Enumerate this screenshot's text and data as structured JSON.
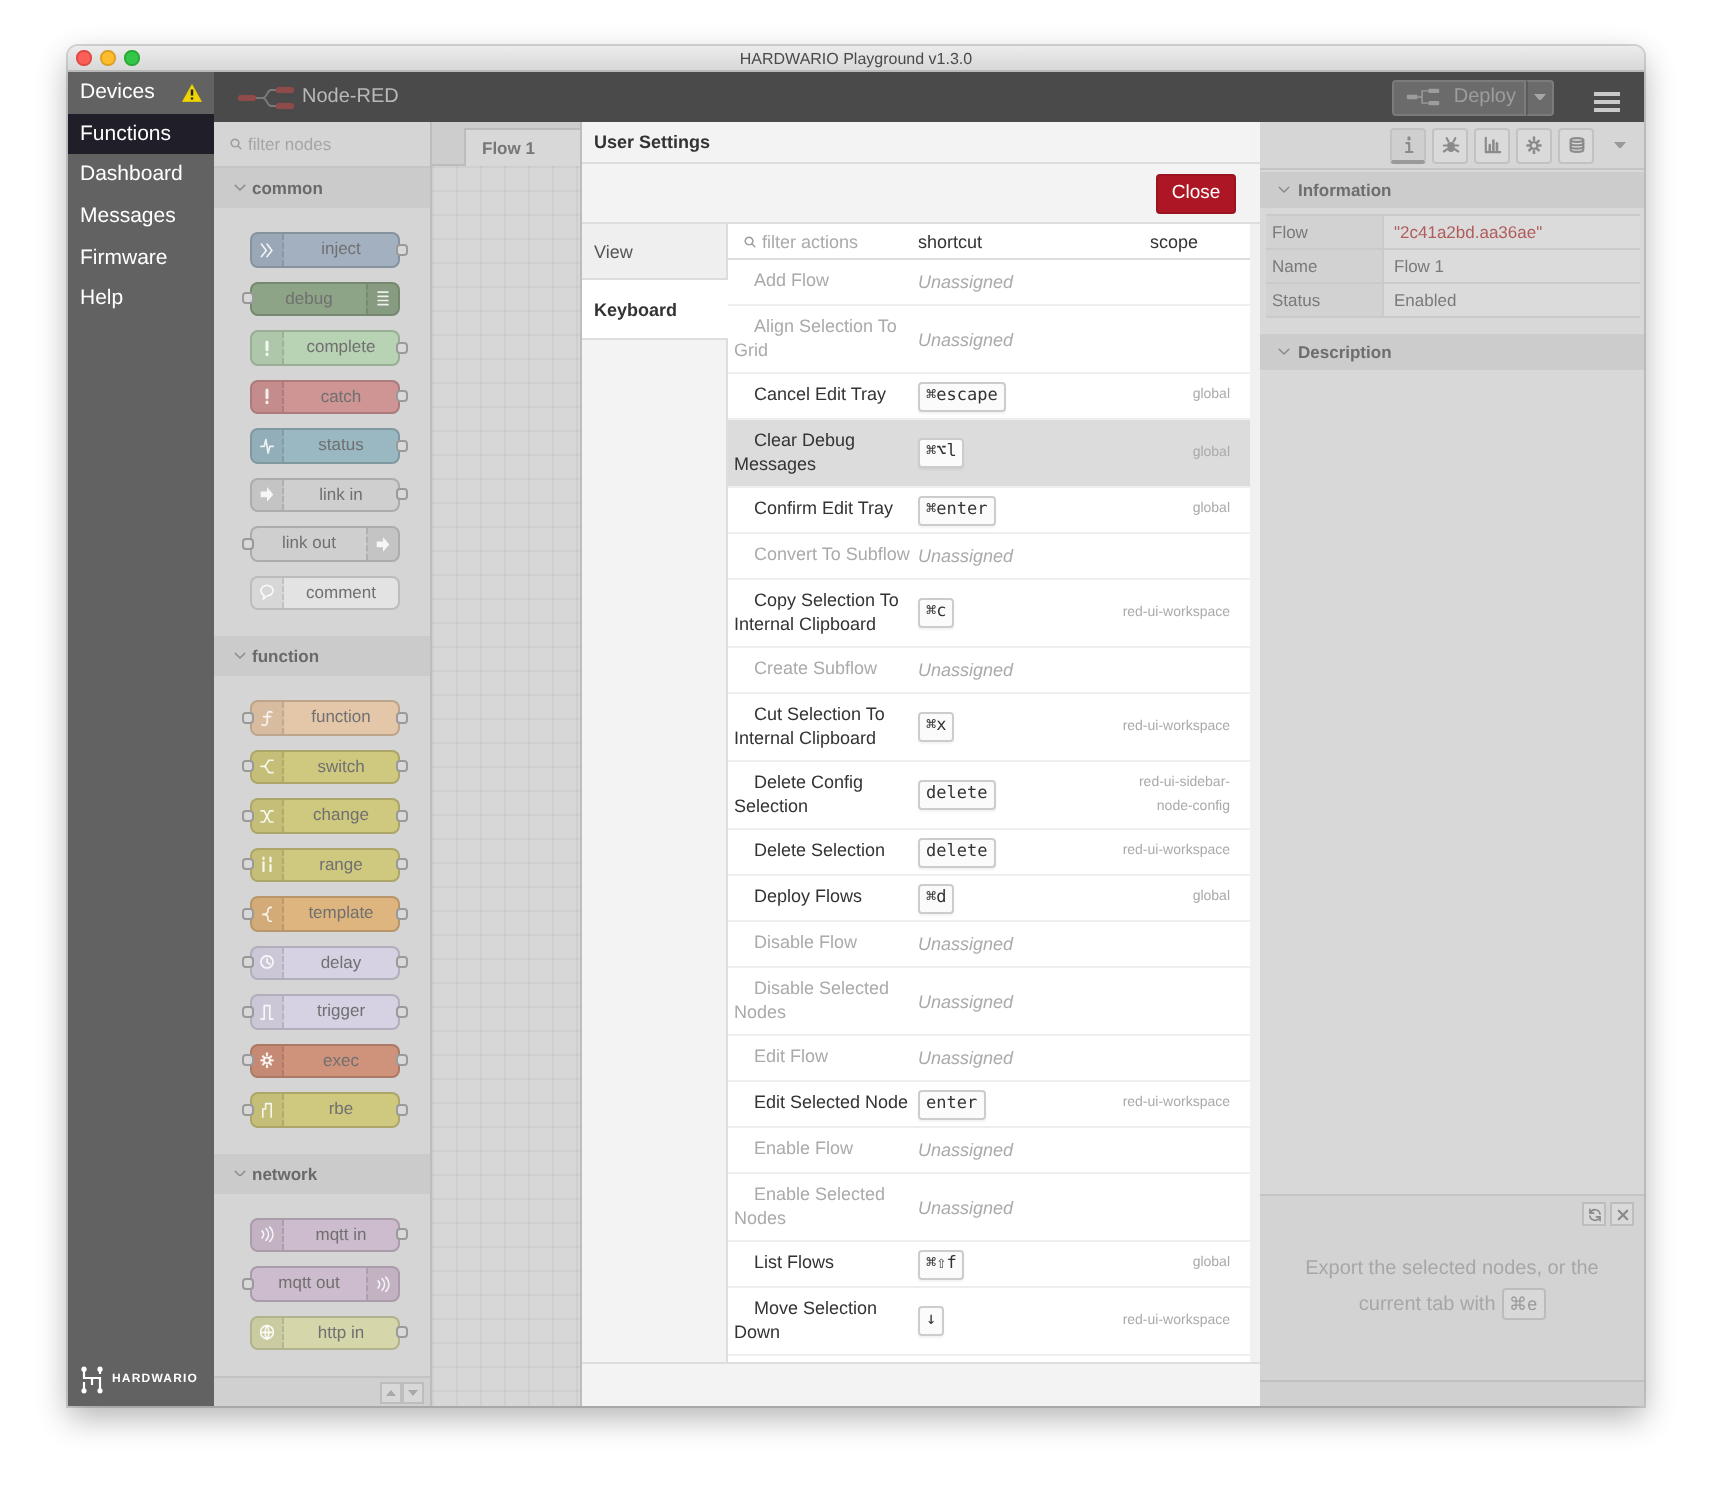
{
  "window": {
    "title": "HARDWARIO Playground v1.3.0"
  },
  "app_sidebar": {
    "items": [
      {
        "label": "Devices",
        "selected": false,
        "warning": true
      },
      {
        "label": "Functions",
        "selected": true,
        "warning": false
      },
      {
        "label": "Dashboard",
        "selected": false,
        "warning": false
      },
      {
        "label": "Messages",
        "selected": false,
        "warning": false
      },
      {
        "label": "Firmware",
        "selected": false,
        "warning": false
      },
      {
        "label": "Help",
        "selected": false,
        "warning": false
      }
    ],
    "logo_text": "HARDWARIO"
  },
  "header": {
    "title": "Node-RED",
    "deploy_button": "Deploy"
  },
  "palette": {
    "search": {
      "placeholder": "filter nodes"
    },
    "categories": [
      {
        "name": "common",
        "expanded": true,
        "nodes": [
          {
            "label": "inject",
            "color": "#a3b0c0",
            "input": false,
            "output": true,
            "icon_right": false
          },
          {
            "label": "debug",
            "color": "#8ea486",
            "input": true,
            "output": false,
            "icon_right": true
          },
          {
            "label": "complete",
            "color": "#b8d2b4",
            "input": false,
            "output": true,
            "icon_right": false
          },
          {
            "label": "catch",
            "color": "#cf9494",
            "input": false,
            "output": true,
            "icon_right": false
          },
          {
            "label": "status",
            "color": "#9ab8c2",
            "input": false,
            "output": true,
            "icon_right": false
          },
          {
            "label": "link in",
            "color": "#cfcfcf",
            "input": false,
            "output": true,
            "icon_right": false
          },
          {
            "label": "link out",
            "color": "#cfcfcf",
            "input": true,
            "output": false,
            "icon_right": true
          },
          {
            "label": "comment",
            "color": "#e3e3e3",
            "input": false,
            "output": false,
            "icon_right": false
          }
        ]
      },
      {
        "name": "function",
        "expanded": true,
        "nodes": [
          {
            "label": "function",
            "color": "#e4c7a8",
            "input": true,
            "output": true,
            "icon_right": false
          },
          {
            "label": "switch",
            "color": "#cfc97f",
            "input": true,
            "output": true,
            "icon_right": false
          },
          {
            "label": "change",
            "color": "#cfc97f",
            "input": true,
            "output": true,
            "icon_right": false
          },
          {
            "label": "range",
            "color": "#cfc97f",
            "input": true,
            "output": true,
            "icon_right": false
          },
          {
            "label": "template",
            "color": "#deb57f",
            "input": true,
            "output": true,
            "icon_right": false
          },
          {
            "label": "delay",
            "color": "#d6d2e3",
            "input": true,
            "output": true,
            "icon_right": false
          },
          {
            "label": "trigger",
            "color": "#d6d2e3",
            "input": true,
            "output": true,
            "icon_right": false
          },
          {
            "label": "exec",
            "color": "#cf927b",
            "input": true,
            "output": true,
            "icon_right": false
          },
          {
            "label": "rbe",
            "color": "#cfc97f",
            "input": true,
            "output": true,
            "icon_right": false
          }
        ]
      },
      {
        "name": "network",
        "expanded": true,
        "nodes": [
          {
            "label": "mqtt in",
            "color": "#cdbccd",
            "input": false,
            "output": true,
            "icon_right": false
          },
          {
            "label": "mqtt out",
            "color": "#cdbccd",
            "input": true,
            "output": false,
            "icon_right": true
          },
          {
            "label": "http in",
            "color": "#d6d6ab",
            "input": false,
            "output": true,
            "icon_right": false
          }
        ]
      }
    ]
  },
  "workspace": {
    "tabs": [
      {
        "label": "Flow 1",
        "selected": true
      }
    ]
  },
  "settings_dialog": {
    "title": "User Settings",
    "close_button": "Close",
    "tabs": [
      {
        "label": "View",
        "selected": false
      },
      {
        "label": "Keyboard",
        "selected": true
      }
    ],
    "filter": {
      "placeholder": "filter actions"
    },
    "columns": [
      "shortcut",
      "scope"
    ],
    "shortcuts": [
      {
        "action": "Add Flow",
        "assigned": false,
        "shortcut": "Unassigned",
        "selected": false
      },
      {
        "action": "Align Selection To Grid",
        "assigned": false,
        "shortcut": "Unassigned",
        "selected": false
      },
      {
        "action": "Cancel Edit Tray",
        "assigned": true,
        "shortcut": "⌘escape",
        "scope": "global",
        "selected": false
      },
      {
        "action": "Clear Debug Messages",
        "assigned": true,
        "shortcut": "⌘⌥l",
        "scope": "global",
        "selected": true
      },
      {
        "action": "Confirm Edit Tray",
        "assigned": true,
        "shortcut": "⌘enter",
        "scope": "global",
        "selected": false
      },
      {
        "action": "Convert To Subflow",
        "assigned": false,
        "shortcut": "Unassigned",
        "selected": false
      },
      {
        "action": "Copy Selection To Internal Clipboard",
        "assigned": true,
        "shortcut": "⌘c",
        "scope": "red-ui-workspace",
        "selected": false
      },
      {
        "action": "Create Subflow",
        "assigned": false,
        "shortcut": "Unassigned",
        "selected": false
      },
      {
        "action": "Cut Selection To Internal Clipboard",
        "assigned": true,
        "shortcut": "⌘x",
        "scope": "red-ui-workspace",
        "selected": false
      },
      {
        "action": "Delete Config Selection",
        "assigned": true,
        "shortcut": "delete",
        "scope": "red-ui-sidebar-node-config",
        "selected": false
      },
      {
        "action": "Delete Selection",
        "assigned": true,
        "shortcut": "delete",
        "scope": "red-ui-workspace",
        "selected": false
      },
      {
        "action": "Deploy Flows",
        "assigned": true,
        "shortcut": "⌘d",
        "scope": "global",
        "selected": false
      },
      {
        "action": "Disable Flow",
        "assigned": false,
        "shortcut": "Unassigned",
        "selected": false
      },
      {
        "action": "Disable Selected Nodes",
        "assigned": false,
        "shortcut": "Unassigned",
        "selected": false
      },
      {
        "action": "Edit Flow",
        "assigned": false,
        "shortcut": "Unassigned",
        "selected": false
      },
      {
        "action": "Edit Selected Node",
        "assigned": true,
        "shortcut": "enter",
        "scope": "red-ui-workspace",
        "selected": false
      },
      {
        "action": "Enable Flow",
        "assigned": false,
        "shortcut": "Unassigned",
        "selected": false
      },
      {
        "action": "Enable Selected Nodes",
        "assigned": false,
        "shortcut": "Unassigned",
        "selected": false
      },
      {
        "action": "List Flows",
        "assigned": true,
        "shortcut": "⌘⇧f",
        "scope": "global",
        "selected": false
      },
      {
        "action": "Move Selection Down",
        "assigned": true,
        "shortcut": "↓",
        "scope": "red-ui-workspace",
        "selected": false
      }
    ]
  },
  "info_sidebar": {
    "tabs": [
      {
        "selected": true
      },
      {
        "selected": false
      },
      {
        "selected": false
      },
      {
        "selected": false
      },
      {
        "selected": false
      }
    ],
    "sections": [
      {
        "title": "Information",
        "expanded": true,
        "rows": [
          {
            "key": "Flow",
            "value": "\"2c41a2bd.aa36ae\"",
            "kind": "id"
          },
          {
            "key": "Name",
            "value": "Flow 1",
            "kind": "text"
          },
          {
            "key": "Status",
            "value": "Enabled",
            "kind": "text"
          }
        ]
      },
      {
        "title": "Description",
        "expanded": true
      }
    ],
    "export_hint": {
      "text": "Export the selected nodes, or the current tab with",
      "shortcut": "⌘e"
    }
  }
}
